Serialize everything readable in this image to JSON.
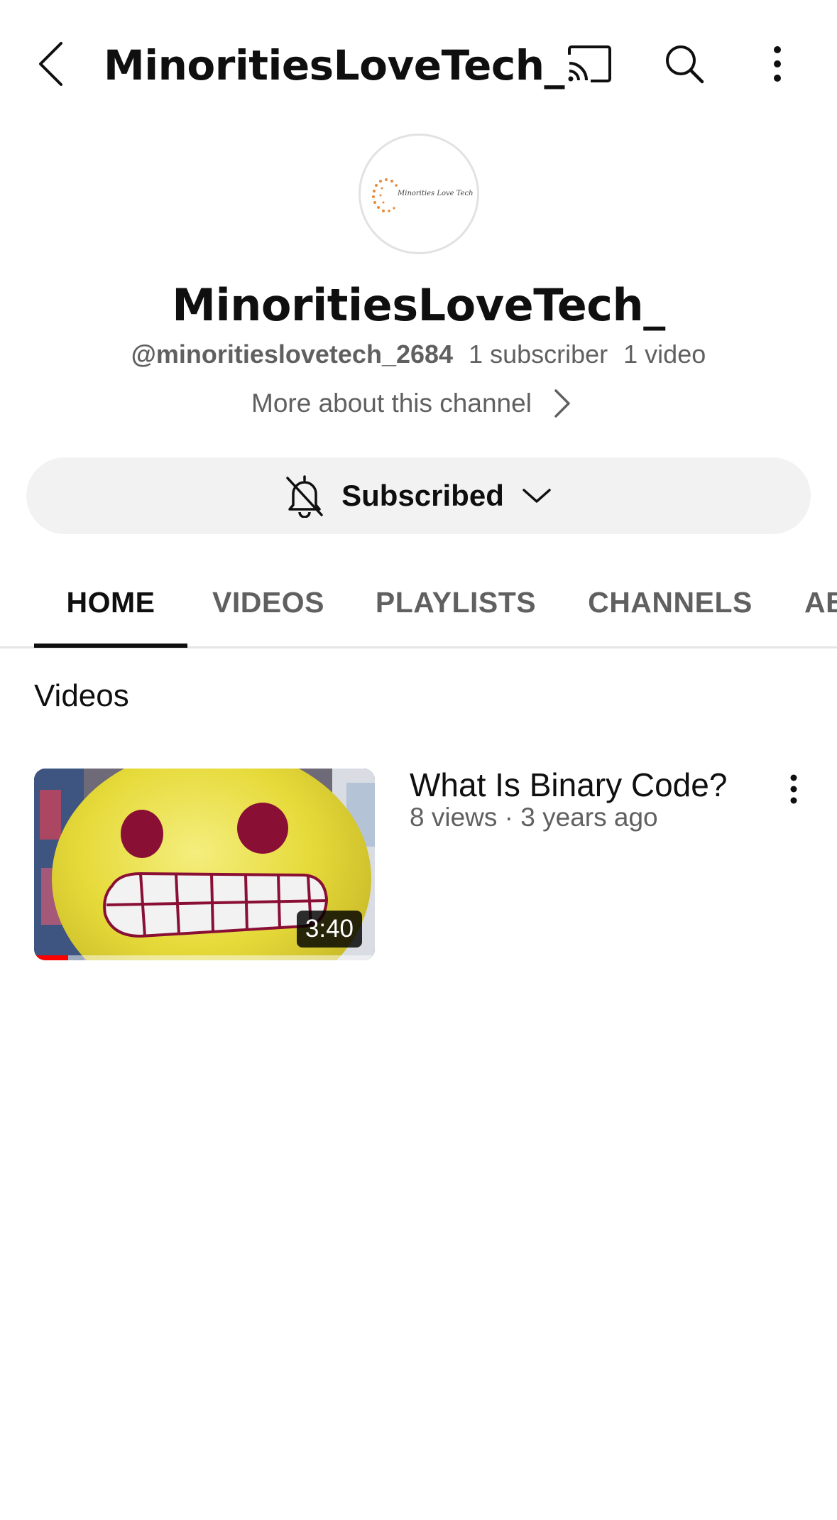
{
  "topbar": {
    "title": "MinoritiesLoveTech_",
    "icons": [
      "back-icon",
      "cast-icon",
      "search-icon",
      "more-vert-icon"
    ]
  },
  "channel": {
    "avatar_text": "Minorities Love Tech",
    "name": "MinoritiesLoveTech_",
    "handle": "@minoritieslovetech_2684",
    "subscribers": "1 subscriber",
    "video_count": "1 video",
    "more_about": "More about this channel"
  },
  "subscribe": {
    "label": "Subscribed",
    "icons": [
      "bell-off-icon",
      "chevron-down-icon"
    ]
  },
  "tabs": [
    {
      "label": "HOME",
      "active": true
    },
    {
      "label": "VIDEOS",
      "active": false
    },
    {
      "label": "PLAYLISTS",
      "active": false
    },
    {
      "label": "CHANNELS",
      "active": false
    },
    {
      "label": "ABOUT",
      "active": false
    }
  ],
  "videos_section": {
    "title": "Videos",
    "items": [
      {
        "title": "What Is Binary Code?",
        "meta": "8 views · 3 years ago",
        "duration": "3:40",
        "watched_fraction": 0.1
      }
    ]
  },
  "colors": {
    "background": "#ffffff",
    "text_primary": "#0f0f0f",
    "text_secondary": "#606060",
    "button_bg": "#f2f2f2",
    "progress_red": "#ff0000"
  }
}
